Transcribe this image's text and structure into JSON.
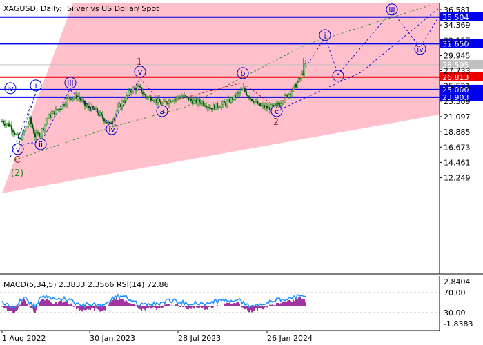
{
  "header": {
    "symbol": "XAGUSD, Daily:",
    "description": "Silver vs US Dollar/ Spot"
  },
  "chart_data": [
    {
      "type": "candlestick",
      "title": "XAGUSD, Daily:  Silver vs US Dollar/ Spot",
      "ylim": [
        10.7,
        37.3
      ],
      "yticks": [
        "36.581",
        "34.369",
        "32.157",
        "29.945",
        "27.733",
        "25.521",
        "23.309",
        "21.097",
        "18.885",
        "16.673",
        "14.461",
        "12.249"
      ],
      "xticks": [
        "1 Aug 2022",
        "30 Jan 2023",
        "28 Jul 2023",
        "26 Jan 2024"
      ],
      "close_approx": [
        {
          "t": 0,
          "v": 20.4
        },
        {
          "t": 12,
          "v": 19.8
        },
        {
          "t": 20,
          "v": 18.4
        },
        {
          "t": 26,
          "v": 17.7
        },
        {
          "t": 32,
          "v": 18.9
        },
        {
          "t": 40,
          "v": 20.6
        },
        {
          "t": 48,
          "v": 18.3
        },
        {
          "t": 56,
          "v": 18.7
        },
        {
          "t": 66,
          "v": 20.9
        },
        {
          "t": 74,
          "v": 21.6
        },
        {
          "t": 86,
          "v": 22.5
        },
        {
          "t": 96,
          "v": 23.8
        },
        {
          "t": 110,
          "v": 24.0
        },
        {
          "t": 122,
          "v": 22.5
        },
        {
          "t": 134,
          "v": 22.1
        },
        {
          "t": 146,
          "v": 20.9
        },
        {
          "t": 156,
          "v": 19.9
        },
        {
          "t": 166,
          "v": 22.0
        },
        {
          "t": 176,
          "v": 23.4
        },
        {
          "t": 188,
          "v": 25.0
        },
        {
          "t": 198,
          "v": 25.3
        },
        {
          "t": 208,
          "v": 24.0
        },
        {
          "t": 218,
          "v": 23.8
        },
        {
          "t": 232,
          "v": 22.9
        },
        {
          "t": 246,
          "v": 23.6
        },
        {
          "t": 262,
          "v": 24.1
        },
        {
          "t": 276,
          "v": 23.3
        },
        {
          "t": 290,
          "v": 23.2
        },
        {
          "t": 302,
          "v": 22.4
        },
        {
          "t": 314,
          "v": 22.7
        },
        {
          "t": 326,
          "v": 23.1
        },
        {
          "t": 340,
          "v": 24.2
        },
        {
          "t": 350,
          "v": 25.0
        },
        {
          "t": 360,
          "v": 23.8
        },
        {
          "t": 372,
          "v": 22.7
        },
        {
          "t": 386,
          "v": 22.3
        },
        {
          "t": 398,
          "v": 22.7
        },
        {
          "t": 410,
          "v": 23.8
        },
        {
          "t": 422,
          "v": 25.1
        },
        {
          "t": 432,
          "v": 26.6
        },
        {
          "t": 440,
          "v": 28.6
        }
      ],
      "current_price": "28.595",
      "levels": [
        {
          "value": 35.504,
          "label": "35.504",
          "color": "#0000ee"
        },
        {
          "value": 31.65,
          "label": "31.650",
          "color": "#0000ee"
        },
        {
          "value": 26.813,
          "label": "26.813",
          "color": "#ee0000"
        },
        {
          "value": 25.0,
          "label": "25.000",
          "color": "#0000ee"
        },
        {
          "value": 23.903,
          "label": "23.903",
          "color": "#0000ee"
        }
      ],
      "wave_labels": [
        {
          "t": 12,
          "v": 25.2,
          "text": "iv",
          "style": "circle"
        },
        {
          "t": 49,
          "v": 25.6,
          "text": "i",
          "style": "circle"
        },
        {
          "t": 23,
          "v": 16.4,
          "text": "v",
          "style": "circle"
        },
        {
          "t": 56,
          "v": 17.1,
          "text": "ii",
          "style": "circle"
        },
        {
          "t": 99,
          "v": 26.0,
          "text": "iii",
          "style": "circle"
        },
        {
          "t": 159,
          "v": 19.3,
          "text": "iv",
          "style": "circle"
        },
        {
          "t": 200,
          "v": 27.6,
          "text": "v",
          "style": "circle"
        },
        {
          "t": 199,
          "v": 29.0,
          "text": "1",
          "style": "plain",
          "color": "#a52a2a"
        },
        {
          "t": 232,
          "v": 21.9,
          "text": "a",
          "style": "circle"
        },
        {
          "t": 349,
          "v": 27.4,
          "text": "b",
          "style": "circle"
        },
        {
          "t": 398,
          "v": 21.9,
          "text": "c",
          "style": "circle"
        },
        {
          "t": 397,
          "v": 20.3,
          "text": "2",
          "style": "plain",
          "color": "#a52a2a"
        },
        {
          "t": 22,
          "v": 14.8,
          "text": "C",
          "style": "plain",
          "color": "#a52a2a"
        },
        {
          "t": 22,
          "v": 12.9,
          "text": "(2)",
          "style": "plain",
          "color": "#228b22"
        },
        {
          "t": 468,
          "v": 32.9,
          "text": "i",
          "style": "circle"
        },
        {
          "t": 487,
          "v": 27.0,
          "text": "ii",
          "style": "circle"
        },
        {
          "t": 565,
          "v": 36.6,
          "text": "iii",
          "style": "circle"
        },
        {
          "t": 606,
          "v": 30.9,
          "text": "iv",
          "style": "circle"
        }
      ]
    },
    {
      "type": "indicator",
      "title": "MACD(5,34,5) 2.3833 2.3566 RSI(14) 72.86",
      "yticks": [
        "2.8404",
        "70.00",
        "30.00",
        "-1.8383"
      ]
    }
  ],
  "colors": {
    "channel_fill": "#ffc0cb",
    "candle": "#228b22",
    "macd_hist": "#8b008b",
    "rsi_line": "#1e90ff",
    "wave_circle": "#0000cd",
    "label_bg_current": "#c0c0c0"
  }
}
